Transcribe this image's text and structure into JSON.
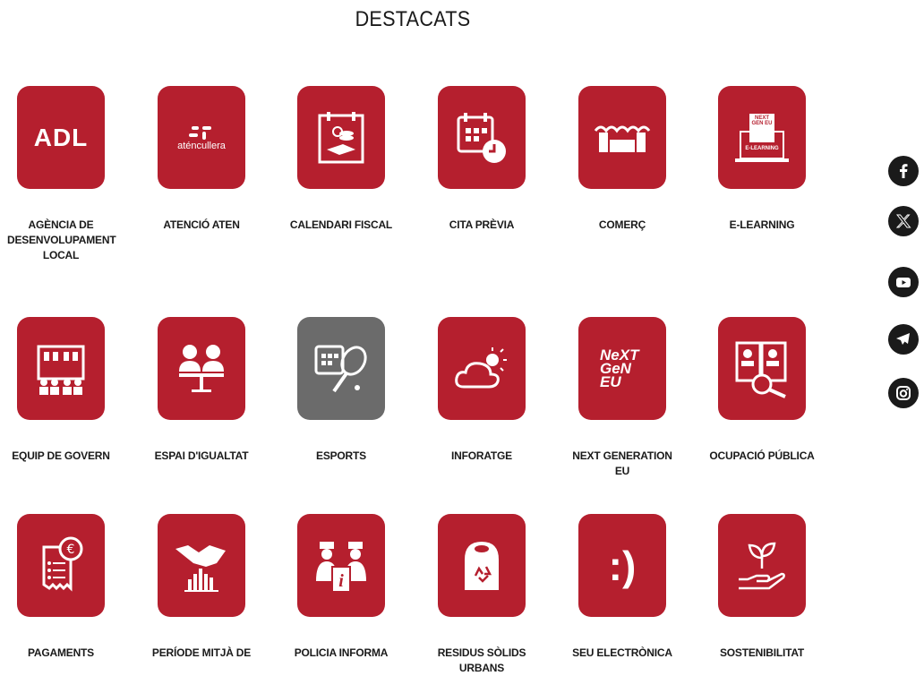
{
  "section": {
    "title": "DESTACATS"
  },
  "tiles": [
    {
      "label": "AGÈNCIA DE DESENVOLUPAMENT LOCAL",
      "icon": "adl-text-icon",
      "icon_text": "ADL"
    },
    {
      "label": "ATENCIÓ ATEN",
      "icon": "atencullera-logo-icon",
      "icon_text": "aténcullera"
    },
    {
      "label": "CALENDARI FISCAL",
      "icon": "calendar-coins-icon"
    },
    {
      "label": "CITA PRÈVIA",
      "icon": "calendar-clock-icon"
    },
    {
      "label": "COMERÇ",
      "icon": "storefront-icon"
    },
    {
      "label": "E-LEARNING",
      "icon": "laptop-book-icon",
      "icon_text": "E-LEARNING",
      "badge_text": "NEXT GEN EU"
    },
    {
      "label": "EQUIP DE GOVERN",
      "icon": "town-hall-icon"
    },
    {
      "label": "ESPAI D'IGUALTAT",
      "icon": "two-people-table-icon"
    },
    {
      "label": "ESPORTS",
      "icon": "calendar-racket-icon"
    },
    {
      "label": "INFORATGE",
      "icon": "cloud-sun-icon"
    },
    {
      "label": "NEXT GENERATION EU",
      "icon": "next-gen-eu-icon",
      "icon_text": "NeXT GeN EU"
    },
    {
      "label": "OCUPACIÓ PÚBLICA",
      "icon": "document-magnifier-icon"
    },
    {
      "label": "PAGAMENTS",
      "icon": "receipt-euro-icon"
    },
    {
      "label": "PERÍODE MITJÀ DE",
      "icon": "handshake-chart-icon"
    },
    {
      "label": "POLICIA INFORMA",
      "icon": "police-info-icon"
    },
    {
      "label": "RESIDUS SÒLIDS URBANS",
      "icon": "recycling-bin-icon"
    },
    {
      "label": "SEU ELECTRÒNICA",
      "icon": "smiley-icon",
      "icon_text": ":)"
    },
    {
      "label": "SOSTENIBILITAT",
      "icon": "hand-plant-icon"
    }
  ],
  "social": [
    {
      "name": "facebook-icon"
    },
    {
      "name": "x-icon"
    },
    {
      "name": "youtube-icon"
    },
    {
      "name": "telegram-icon"
    },
    {
      "name": "instagram-icon"
    }
  ],
  "colors": {
    "tile_red": "#b51f2e",
    "tile_gray": "#6b6b6b",
    "social_bg": "#1a1a1a",
    "text": "#1a1a1a"
  }
}
